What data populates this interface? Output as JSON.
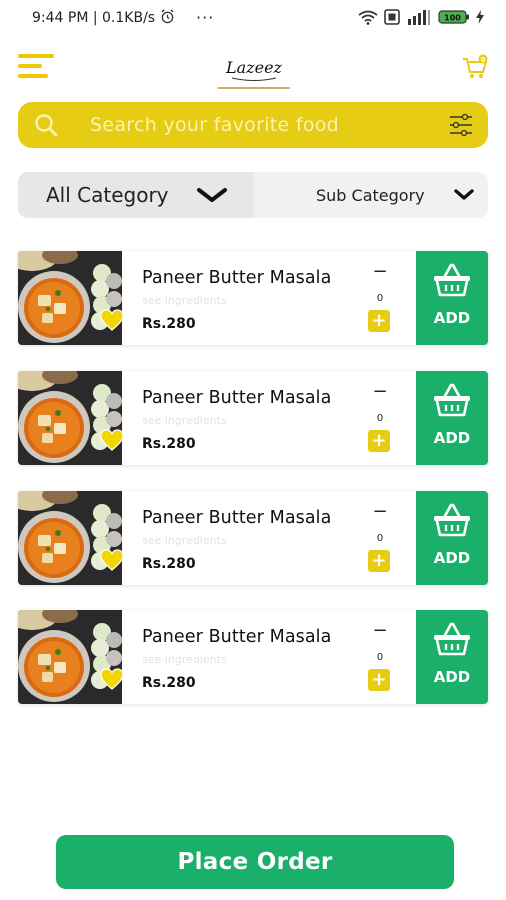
{
  "status_bar": {
    "time_speed": "9:44 PM | 0.1KB/s",
    "more": "···",
    "battery_level": "100",
    "icons": [
      "alarm-icon",
      "wifi-icon",
      "data-saver-icon",
      "signal-icon",
      "battery-icon",
      "charging-icon"
    ]
  },
  "header": {
    "logo_text": "Lazeez"
  },
  "search": {
    "placeholder": "Search your favorite food"
  },
  "categories": {
    "all_label": "All Category",
    "sub_label": "Sub Category"
  },
  "products": [
    {
      "name": "Paneer Butter Masala",
      "ingredients_link": "see ingredients",
      "price": "Rs.280",
      "quantity": "0",
      "minus": "−",
      "plus": "+",
      "add_label": "ADD"
    },
    {
      "name": "Paneer Butter Masala",
      "ingredients_link": "see ingredients",
      "price": "Rs.280",
      "quantity": "0",
      "minus": "−",
      "plus": "+",
      "add_label": "ADD"
    },
    {
      "name": "Paneer Butter Masala",
      "ingredients_link": "see ingredients",
      "price": "Rs.280",
      "quantity": "0",
      "minus": "−",
      "plus": "+",
      "add_label": "ADD"
    },
    {
      "name": "Paneer Butter Masala",
      "ingredients_link": "see ingredients",
      "price": "Rs.280",
      "quantity": "0",
      "minus": "−",
      "plus": "+",
      "add_label": "ADD"
    }
  ],
  "footer": {
    "place_order_label": "Place Order"
  },
  "colors": {
    "accent_yellow": "#e6cc12",
    "accent_green": "#1bb06a"
  }
}
